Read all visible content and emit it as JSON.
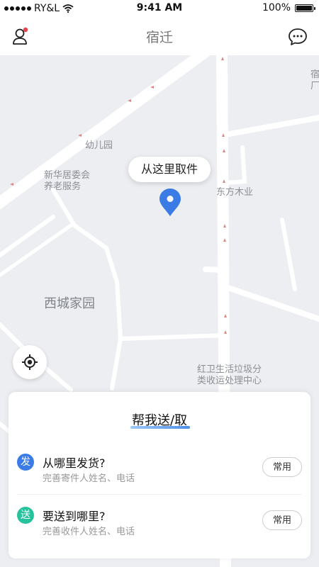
{
  "status_bar": {
    "carrier": "RY&L",
    "time": "9:41 AM",
    "battery": "100%",
    "battery_level": 1.0
  },
  "nav": {
    "title": "宿迁",
    "left_icon": "user-icon",
    "right_icon": "chat-icon"
  },
  "map": {
    "labels": {
      "kindergarten": "幼儿园",
      "committee": "新华居委会\n养老服务",
      "dongfang": "东方木业",
      "xicheng": "西城家园",
      "garbage": "红卫生活垃圾分\n类收运处理中心",
      "edge": "宿\n厂"
    },
    "pickup_bubble": "从这里取件",
    "pin_color": "#3a7be6",
    "locate_icon": "locate-icon"
  },
  "card": {
    "title": "帮我送/取",
    "send": {
      "badge": "发",
      "title": "从哪里发货?",
      "subtitle": "完善寄件人姓名、电话",
      "button": "常用",
      "color": "#3a7be6"
    },
    "receive": {
      "badge": "送",
      "title": "要送到哪里?",
      "subtitle": "完善收件人姓名、电话",
      "button": "常用",
      "color": "#26c29e"
    }
  }
}
